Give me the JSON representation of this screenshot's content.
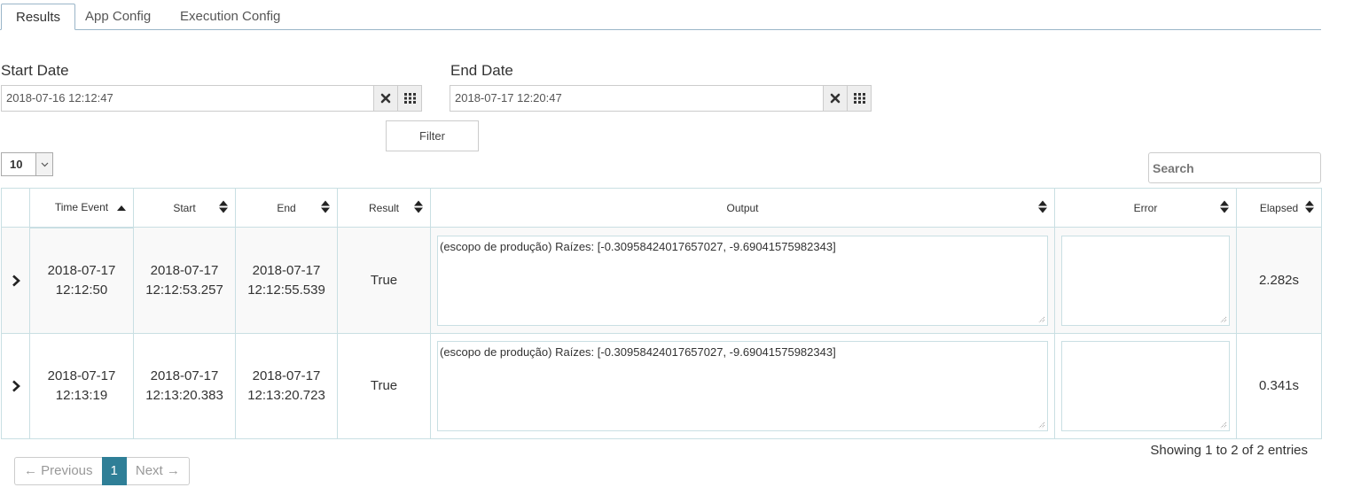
{
  "tabs": [
    {
      "label": "Results"
    },
    {
      "label": "App Config"
    },
    {
      "label": "Execution Config"
    }
  ],
  "filters": {
    "start_label": "Start Date",
    "start_value": "2018-07-16 12:12:47",
    "end_label": "End Date",
    "end_value": "2018-07-17 12:20:47",
    "filter_button": "Filter"
  },
  "length": {
    "selected": "10"
  },
  "search": {
    "placeholder": "Search"
  },
  "table": {
    "headers": [
      "Time Event",
      "Start",
      "End",
      "Result",
      "Output",
      "Error",
      "Elapsed"
    ],
    "rows": [
      {
        "time_event_date": "2018-07-17",
        "time_event_time": "12:12:50",
        "start_date": "2018-07-17",
        "start_time": "12:12:53.257",
        "end_date": "2018-07-17",
        "end_time": "12:12:55.539",
        "result": "True",
        "output": "(escopo de produção) Raízes: [-0.30958424017657027, -9.69041575982343]",
        "error": "",
        "elapsed": "2.282s"
      },
      {
        "time_event_date": "2018-07-17",
        "time_event_time": "12:13:19",
        "start_date": "2018-07-17",
        "start_time": "12:13:20.383",
        "end_date": "2018-07-17",
        "end_time": "12:13:20.723",
        "result": "True",
        "output": "(escopo de produção) Raízes: [-0.30958424017657027, -9.69041575982343]",
        "error": "",
        "elapsed": "0.341s"
      }
    ]
  },
  "info": "Showing 1 to 2 of 2 entries",
  "pagination": {
    "previous": "← Previous",
    "current": "1",
    "next": "Next →"
  },
  "colors": {
    "accent": "#2f7f97",
    "border": "#c9dfe3"
  }
}
